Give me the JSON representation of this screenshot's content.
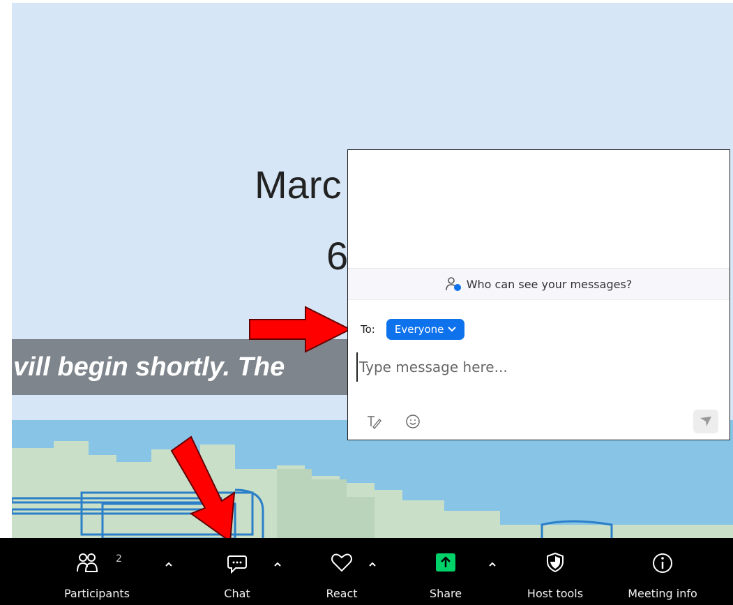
{
  "slide": {
    "title_fragment": "Marc",
    "subtitle_fragment": "6",
    "banner_text": "vill begin shortly.  The"
  },
  "chat": {
    "who_can_see": "Who can see your messages?",
    "to_label": "To:",
    "recipient": "Everyone",
    "placeholder": "Type message here..."
  },
  "toolbar": {
    "participants_label": "Participants",
    "participants_count": "2",
    "chat_label": "Chat",
    "react_label": "React",
    "share_label": "Share",
    "host_tools_label": "Host tools",
    "meeting_info_label": "Meeting info"
  },
  "colors": {
    "accent_blue": "#0e72ed",
    "share_green": "#00d26a",
    "annotation_red": "#ff0000"
  }
}
